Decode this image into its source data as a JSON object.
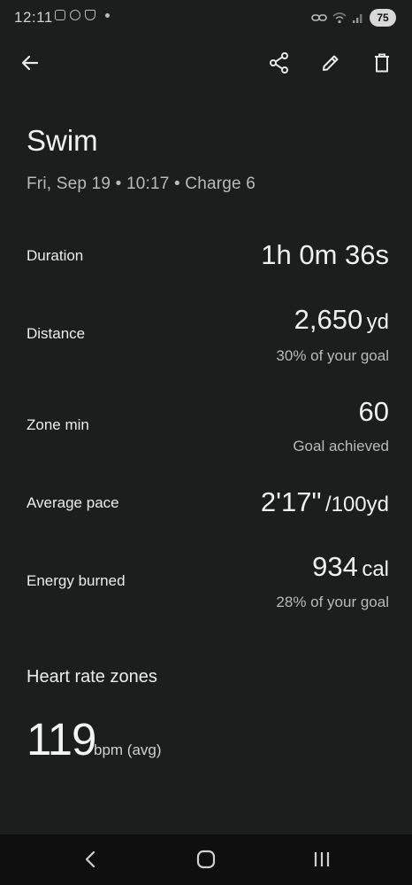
{
  "status": {
    "time": "12:11",
    "battery": "75"
  },
  "header": {
    "back": "back-arrow-icon",
    "actions": [
      "share-icon",
      "edit-pencil-icon",
      "delete-trash-icon"
    ]
  },
  "activity": {
    "title": "Swim",
    "subtitle": "Fri, Sep 19 • 10:17 • Charge 6"
  },
  "stats": {
    "duration": {
      "label": "Duration",
      "value": "1h 0m 36s"
    },
    "distance": {
      "label": "Distance",
      "value": "2,650",
      "unit": "yd",
      "sub": "30% of your goal"
    },
    "zone_min": {
      "label": "Zone min",
      "value": "60",
      "sub": "Goal achieved"
    },
    "avg_pace": {
      "label": "Average pace",
      "value": "2'17\"",
      "unit": "/100yd"
    },
    "energy": {
      "label": "Energy burned",
      "value": "934",
      "unit": "cal",
      "sub": "28% of your goal"
    }
  },
  "heart": {
    "section_title": "Heart rate zones",
    "avg_value": "119",
    "avg_unit": "bpm (avg)"
  },
  "colors": {
    "background": "#1c1d1d",
    "nav_bar": "#0f0f0f",
    "text_primary": "#f0f0f0",
    "text_secondary": "#b9b9b9"
  }
}
